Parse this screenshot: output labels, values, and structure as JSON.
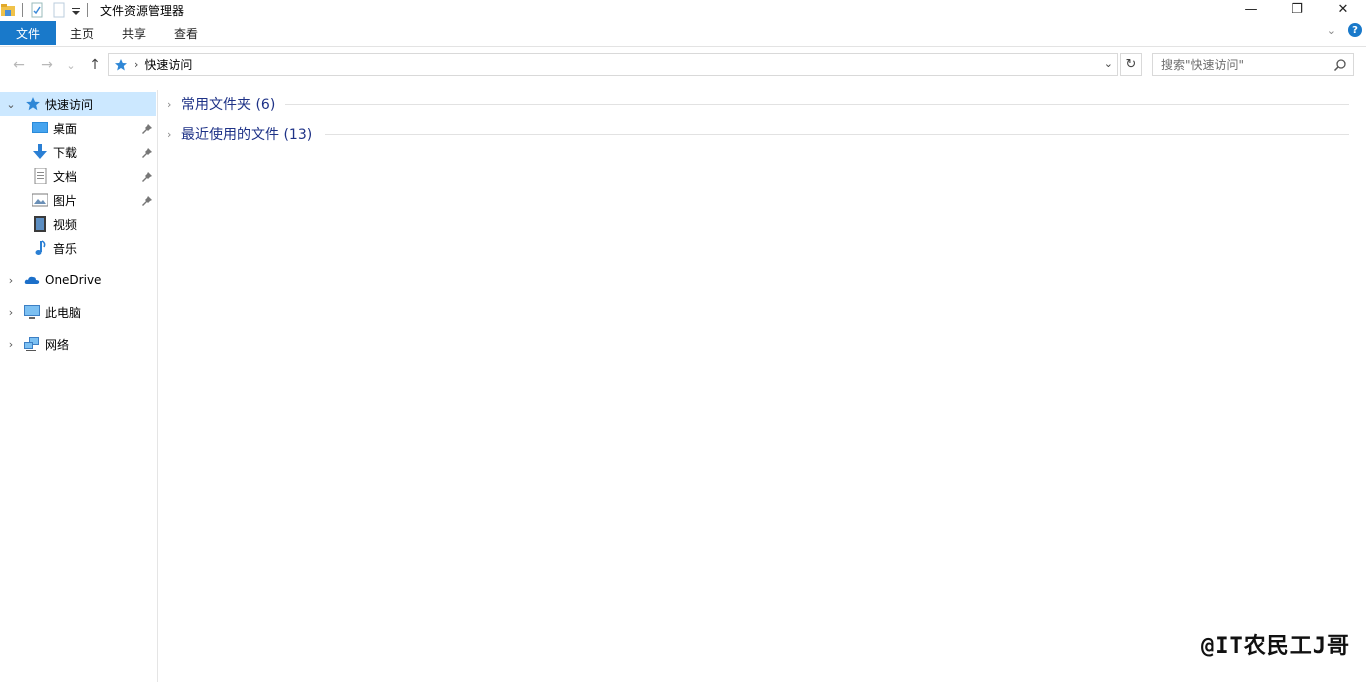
{
  "window": {
    "title": "文件资源管理器",
    "minimize_glyph": "—",
    "restore_glyph": "❐",
    "close_glyph": "✕"
  },
  "ribbon": {
    "tabs": [
      {
        "label": "文件"
      },
      {
        "label": "主页"
      },
      {
        "label": "共享"
      },
      {
        "label": "查看"
      }
    ],
    "help_label": "?"
  },
  "address": {
    "breadcrumb": "快速访问",
    "back_glyph": "←",
    "forward_glyph": "→",
    "recent_glyph": "⌄",
    "up_glyph": "↑",
    "refresh_glyph": "↻"
  },
  "search": {
    "placeholder": "搜索\"快速访问\""
  },
  "sidebar": {
    "quick_access": "快速访问",
    "items": [
      {
        "label": "桌面",
        "icon": "desktop-icon",
        "pinned": true
      },
      {
        "label": "下载",
        "icon": "download-icon",
        "pinned": true
      },
      {
        "label": "文档",
        "icon": "document-icon",
        "pinned": true
      },
      {
        "label": "图片",
        "icon": "picture-icon",
        "pinned": true
      },
      {
        "label": "视频",
        "icon": "video-icon",
        "pinned": false
      },
      {
        "label": "音乐",
        "icon": "music-icon",
        "pinned": false
      }
    ],
    "onedrive": "OneDrive",
    "this_pc": "此电脑",
    "network": "网络"
  },
  "content": {
    "groups": [
      {
        "label": "常用文件夹 (6)"
      },
      {
        "label": "最近使用的文件 (13)"
      }
    ]
  },
  "watermark": "@IT农民工J哥",
  "colors": {
    "accent": "#1979ca",
    "selected": "#cce8ff",
    "group_text": "#1e3287"
  }
}
